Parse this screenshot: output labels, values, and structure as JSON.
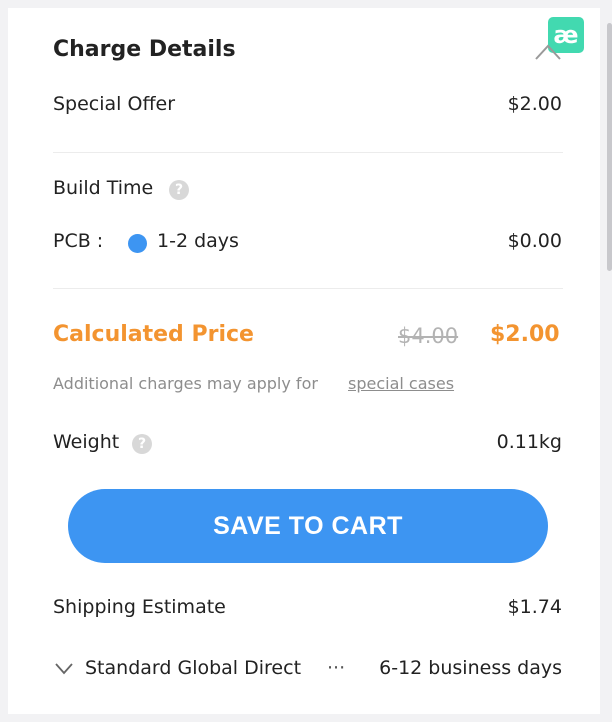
{
  "header": {
    "title": "Charge Details",
    "logo_text": "æ",
    "logo_color": "#42d9b0"
  },
  "special_offer": {
    "label": "Special Offer",
    "value": "$2.00"
  },
  "build_time": {
    "label": "Build Time",
    "help": "?"
  },
  "pcb": {
    "label": "PCB :",
    "option": "1-2 days",
    "value": "$0.00"
  },
  "calculated": {
    "label": "Calculated Price",
    "old_price": "$4.00",
    "new_price": "$2.00",
    "accent": "#f39430"
  },
  "note": {
    "text": "Additional charges may apply for",
    "link": "special cases"
  },
  "weight": {
    "label": "Weight",
    "help": "?",
    "value": "0.11kg"
  },
  "cart_button": {
    "label": "SAVE TO CART",
    "color": "#3d95f2"
  },
  "shipping": {
    "label": "Shipping Estimate",
    "value": "$1.74",
    "method": "Standard Global Direct",
    "more": "···",
    "time": "6-12 business days"
  }
}
